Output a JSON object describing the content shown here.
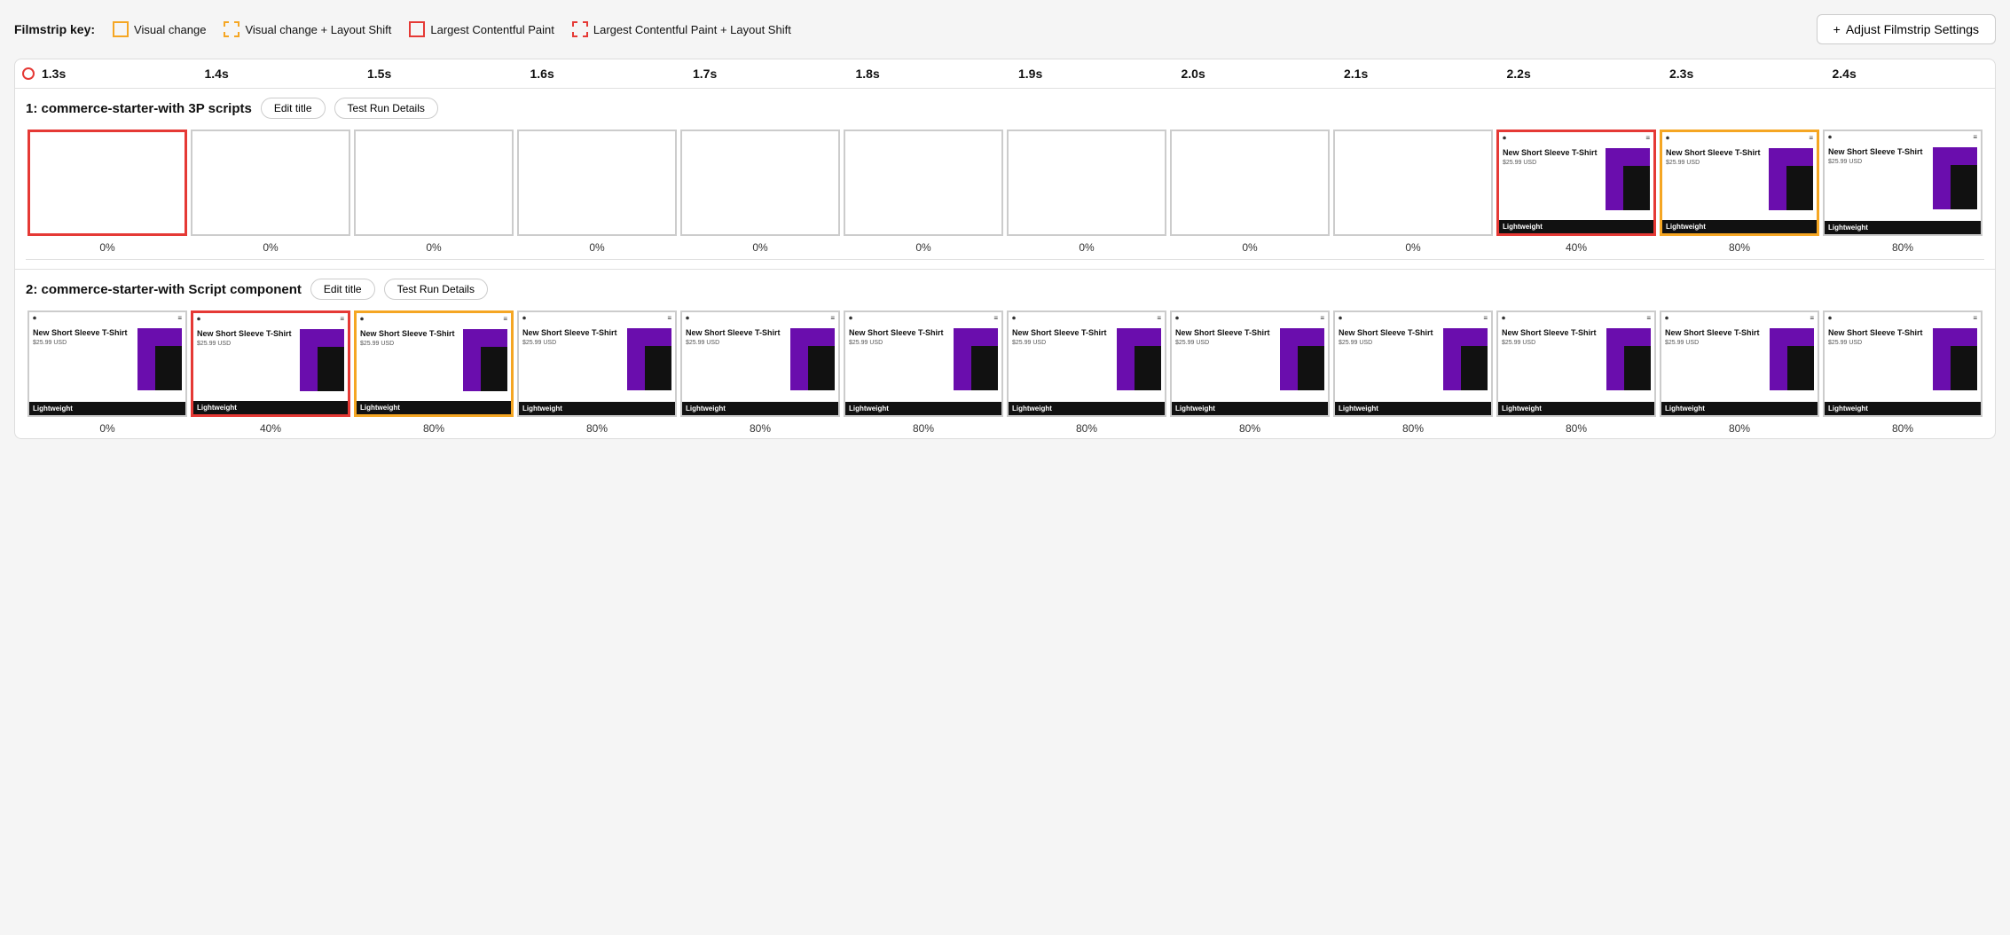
{
  "legend": {
    "title": "Filmstrip key:",
    "items": [
      {
        "id": "visual-change",
        "label": "Visual change",
        "border_style": "solid",
        "color": "orange"
      },
      {
        "id": "visual-change-layout",
        "label": "Visual change + Layout Shift",
        "border_style": "dashed",
        "color": "orange"
      },
      {
        "id": "lcp",
        "label": "Largest Contentful Paint",
        "border_style": "solid",
        "color": "red"
      },
      {
        "id": "lcp-layout",
        "label": "Largest Contentful Paint + Layout Shift",
        "border_style": "dashed",
        "color": "red"
      }
    ]
  },
  "adjust_button": {
    "label": "Adjust Filmstrip Settings",
    "icon": "+"
  },
  "timeline": {
    "labels": [
      "1.3s",
      "1.4s",
      "1.5s",
      "1.6s",
      "1.7s",
      "1.8s",
      "1.9s",
      "2.0s",
      "2.1s",
      "2.2s",
      "2.3s",
      "2.4s"
    ]
  },
  "runs": [
    {
      "id": "run1",
      "title": "1: commerce-starter-with 3P scripts",
      "edit_title_label": "Edit title",
      "test_run_label": "Test Run Details",
      "frames": [
        {
          "id": "f1",
          "border": "red",
          "empty": true,
          "percent": "0%"
        },
        {
          "id": "f2",
          "border": "none",
          "empty": true,
          "percent": "0%"
        },
        {
          "id": "f3",
          "border": "none",
          "empty": true,
          "percent": "0%"
        },
        {
          "id": "f4",
          "border": "none",
          "empty": true,
          "percent": "0%"
        },
        {
          "id": "f5",
          "border": "none",
          "empty": true,
          "percent": "0%"
        },
        {
          "id": "f6",
          "border": "none",
          "empty": true,
          "percent": "0%"
        },
        {
          "id": "f7",
          "border": "none",
          "empty": true,
          "percent": "0%"
        },
        {
          "id": "f8",
          "border": "none",
          "empty": true,
          "percent": "0%"
        },
        {
          "id": "f9",
          "border": "none",
          "empty": true,
          "percent": "0%"
        },
        {
          "id": "f10",
          "border": "red",
          "empty": false,
          "percent": "40%"
        },
        {
          "id": "f11",
          "border": "orange",
          "empty": false,
          "percent": "80%"
        },
        {
          "id": "f12",
          "border": "none",
          "empty": false,
          "percent": "80%"
        }
      ]
    },
    {
      "id": "run2",
      "title": "2: commerce-starter-with Script component",
      "edit_title_label": "Edit title",
      "test_run_label": "Test Run Details",
      "frames": [
        {
          "id": "g1",
          "border": "none",
          "empty": false,
          "percent": "0%"
        },
        {
          "id": "g2",
          "border": "red",
          "empty": false,
          "percent": "40%"
        },
        {
          "id": "g3",
          "border": "orange",
          "empty": false,
          "percent": "80%"
        },
        {
          "id": "g4",
          "border": "none",
          "empty": false,
          "percent": "80%"
        },
        {
          "id": "g5",
          "border": "none",
          "empty": false,
          "percent": "80%"
        },
        {
          "id": "g6",
          "border": "none",
          "empty": false,
          "percent": "80%"
        },
        {
          "id": "g7",
          "border": "none",
          "empty": false,
          "percent": "80%"
        },
        {
          "id": "g8",
          "border": "none",
          "empty": false,
          "percent": "80%"
        },
        {
          "id": "g9",
          "border": "none",
          "empty": false,
          "percent": "80%"
        },
        {
          "id": "g10",
          "border": "none",
          "empty": false,
          "percent": "80%"
        },
        {
          "id": "g11",
          "border": "none",
          "empty": false,
          "percent": "80%"
        },
        {
          "id": "g12",
          "border": "none",
          "empty": false,
          "percent": "80%"
        }
      ]
    }
  ],
  "product": {
    "title": "New Short Sleeve T-Shirt",
    "price": "$25.99 USD",
    "footer": "Lightweight"
  }
}
